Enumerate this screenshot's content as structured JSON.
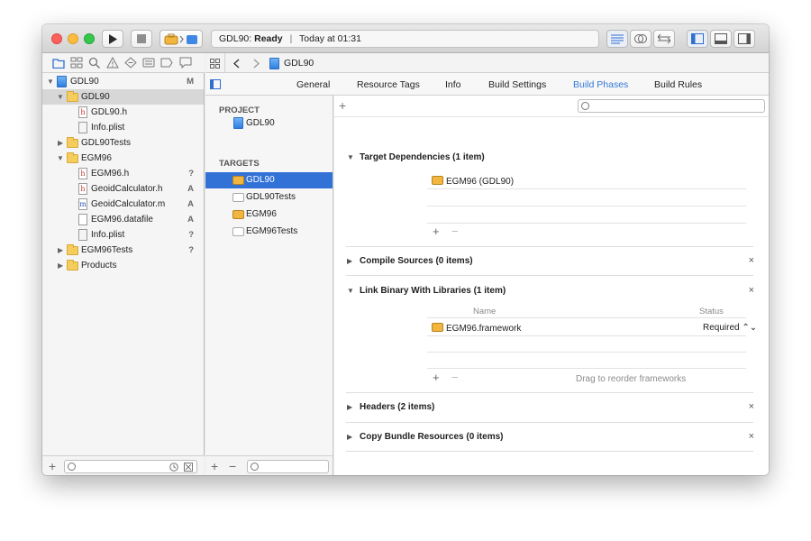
{
  "toolbar": {
    "status_project": "GDL90",
    "status_state": "Ready",
    "status_sep": "|",
    "status_time": "Today at 01:31"
  },
  "navigator": {
    "rows": [
      {
        "label": "GDL90",
        "badge": "M"
      },
      {
        "label": "GDL90",
        "badge": ""
      },
      {
        "label": "GDL90.h",
        "badge": ""
      },
      {
        "label": "Info.plist",
        "badge": ""
      },
      {
        "label": "GDL90Tests",
        "badge": ""
      },
      {
        "label": "EGM96",
        "badge": ""
      },
      {
        "label": "EGM96.h",
        "badge": "?"
      },
      {
        "label": "GeoidCalculator.h",
        "badge": "A"
      },
      {
        "label": "GeoidCalculator.m",
        "badge": "A"
      },
      {
        "label": "EGM96.datafile",
        "badge": "A"
      },
      {
        "label": "Info.plist",
        "badge": "?"
      },
      {
        "label": "EGM96Tests",
        "badge": "?"
      },
      {
        "label": "Products",
        "badge": ""
      }
    ],
    "add": "+"
  },
  "jumpbar": {
    "project": "GDL90"
  },
  "tabs": [
    "General",
    "Resource Tags",
    "Info",
    "Build Settings",
    "Build Phases",
    "Build Rules"
  ],
  "targets_panel": {
    "project_header": "PROJECT",
    "project_name": "GDL90",
    "targets_header": "TARGETS",
    "targets": [
      "GDL90",
      "GDL90Tests",
      "EGM96",
      "EGM96Tests"
    ],
    "add": "+",
    "remove": "−"
  },
  "phases": {
    "add": "+",
    "target_deps": {
      "title": "Target Dependencies (1 item)",
      "items": [
        "EGM96 (GDL90)"
      ]
    },
    "compile": {
      "title": "Compile Sources (0 items)"
    },
    "link": {
      "title": "Link Binary With Libraries (1 item)",
      "col_name": "Name",
      "col_status": "Status",
      "items": [
        {
          "name": "EGM96.framework",
          "status": "Required ⌃⌄"
        }
      ],
      "hint": "Drag to reorder frameworks"
    },
    "headers": {
      "title": "Headers (2 items)"
    },
    "copy_bundle": {
      "title": "Copy Bundle Resources (0 items)"
    },
    "close": "×",
    "plus": "+",
    "minus": "−",
    "tri_open": "▼",
    "tri_closed": "▶"
  },
  "icons": {
    "run": "run-icon",
    "stop": "stop-icon",
    "scheme": "scheme-icon",
    "editor_standard": "editor-standard-icon",
    "editor_assistant": "editor-assistant-icon",
    "editor_version": "editor-version-icon",
    "toggle_navigator": "toggle-navigator-icon",
    "toggle_debug": "toggle-debug-icon",
    "toggle_utilities": "toggle-utilities-icon"
  }
}
